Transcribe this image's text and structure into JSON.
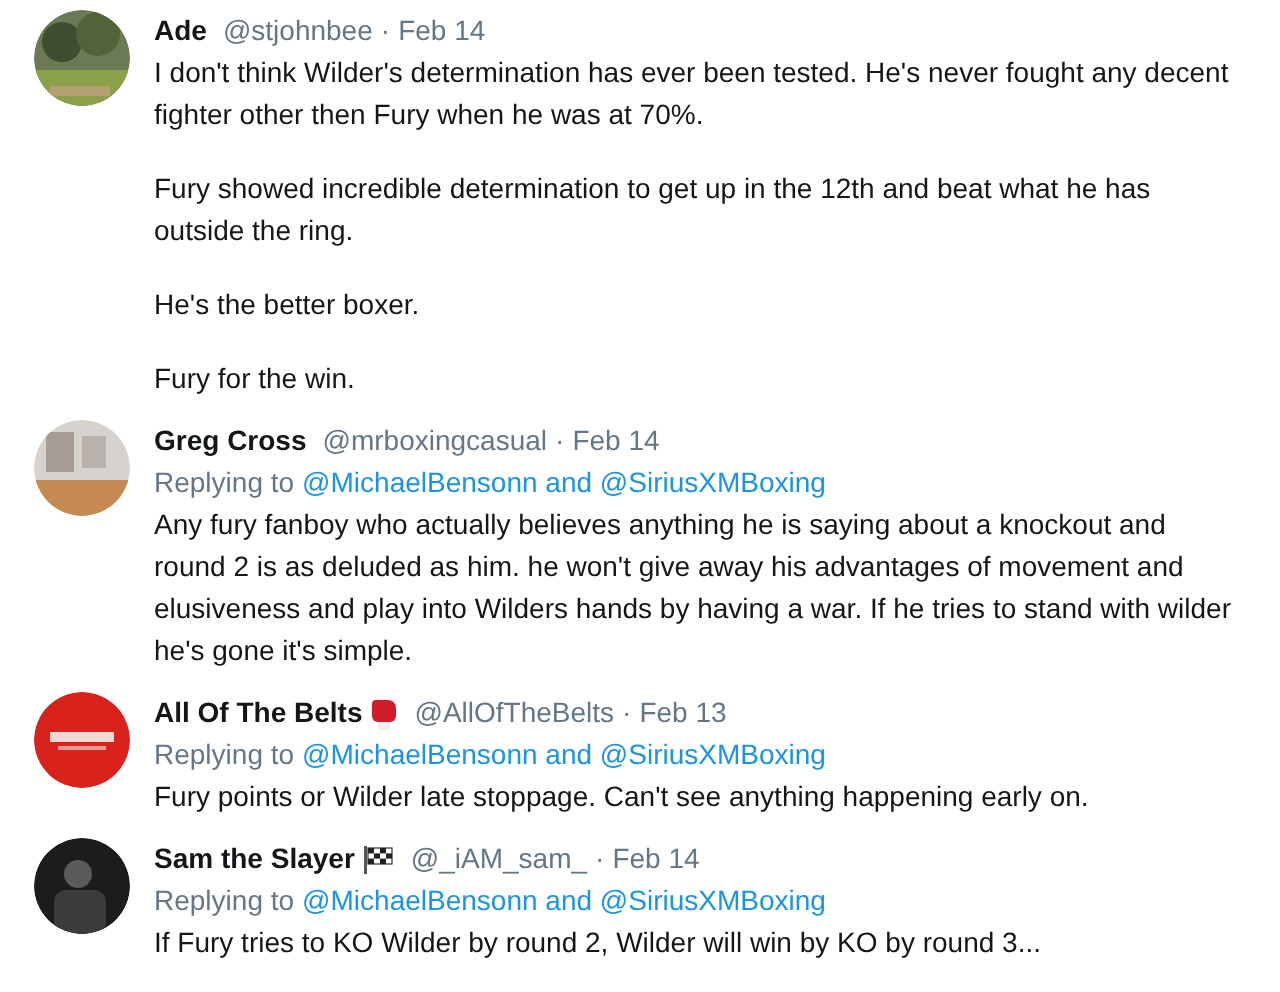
{
  "tweets": [
    {
      "name": "Ade",
      "handle": "@stjohnbee",
      "separator": "·",
      "date": "Feb 14",
      "paragraphs": [
        "I don't think Wilder's determination has ever been tested. He's never fought any decent fighter other then Fury when he was at 70%.",
        "Fury showed incredible determination to get up in the 12th and beat what he has outside the ring.",
        "He's the better boxer.",
        "Fury for the win."
      ]
    },
    {
      "name": "Greg Cross",
      "handle": "@mrboxingcasual",
      "separator": "·",
      "date": "Feb 14",
      "replying_label": "Replying to",
      "replying_to": "@MichaelBensonn and @SiriusXMBoxing",
      "paragraphs": [
        "Any fury fanboy who actually believes anything he is saying about a knockout and round 2 is as deluded as him. he won't give away his advantages of movement and elusiveness and play into Wilders hands by having a war. If he tries to stand with wilder he's gone it's simple."
      ]
    },
    {
      "name": "All Of The Belts",
      "badge": {
        "kind": "glove"
      },
      "handle": "@AllOfTheBelts",
      "separator": "·",
      "date": "Feb 13",
      "replying_label": "Replying to",
      "replying_to": "@MichaelBensonn and @SiriusXMBoxing",
      "paragraphs": [
        "Fury points or Wilder late stoppage. Can't see anything happening early on."
      ]
    },
    {
      "name": "Sam the Slayer",
      "badge": {
        "kind": "flag"
      },
      "handle": "@_iAM_sam_",
      "separator": "·",
      "date": "Feb 14",
      "replying_label": "Replying to",
      "replying_to": "@MichaelBensonn and @SiriusXMBoxing",
      "paragraphs": [
        "If Fury tries to KO Wilder by round 2, Wilder will win by KO by round 3..."
      ]
    }
  ]
}
